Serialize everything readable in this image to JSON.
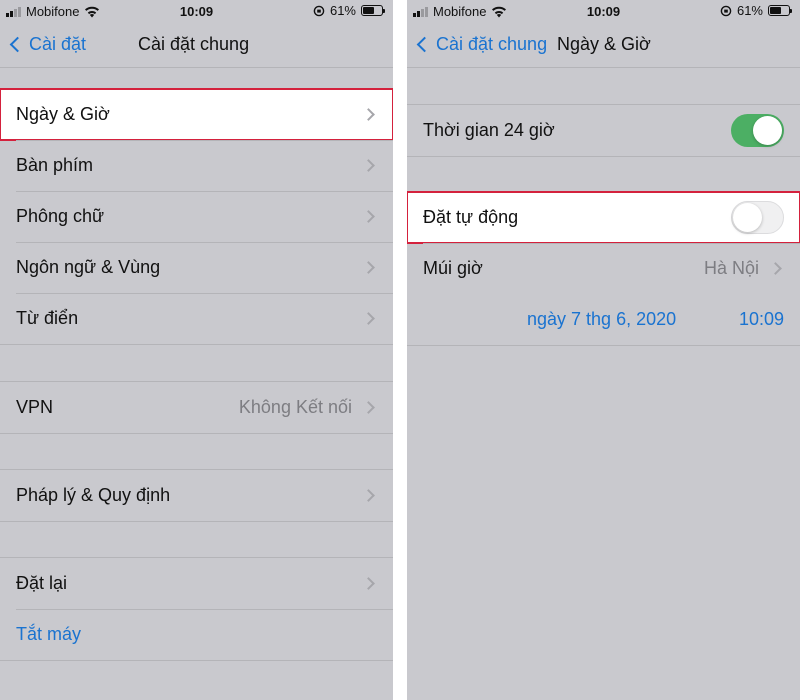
{
  "status_bar": {
    "carrier": "Mobifone",
    "time": "10:09",
    "battery": "61%"
  },
  "left": {
    "nav": {
      "back_label": "Cài đặt",
      "title": "Cài đặt chung"
    },
    "group1": [
      {
        "label": "Ngày & Giờ",
        "highlighted": true
      },
      {
        "label": "Bàn phím"
      },
      {
        "label": "Phông chữ"
      },
      {
        "label": "Ngôn ngữ & Vùng"
      },
      {
        "label": "Từ điển"
      }
    ],
    "vpn": {
      "label": "VPN",
      "value": "Không Kết nối"
    },
    "legal": {
      "label": "Pháp lý & Quy định"
    },
    "reset": {
      "label": "Đặt lại"
    },
    "shutdown": {
      "label": "Tắt máy"
    }
  },
  "right": {
    "nav": {
      "back_label": "Cài đặt chung",
      "title": "Ngày & Giờ"
    },
    "time24": {
      "label": "Thời gian 24 giờ",
      "enabled": true
    },
    "auto_set": {
      "label": "Đặt tự động",
      "enabled": false
    },
    "timezone": {
      "label": "Múi giờ",
      "value": "Hà Nội"
    },
    "datetime": {
      "date": "ngày 7 thg 6, 2020",
      "time": "10:09"
    }
  },
  "colors": {
    "accent": "#1a73d0",
    "highlight_border": "#d4213d",
    "toggle_on": "#4caf64",
    "background": "#c9c9ce"
  }
}
